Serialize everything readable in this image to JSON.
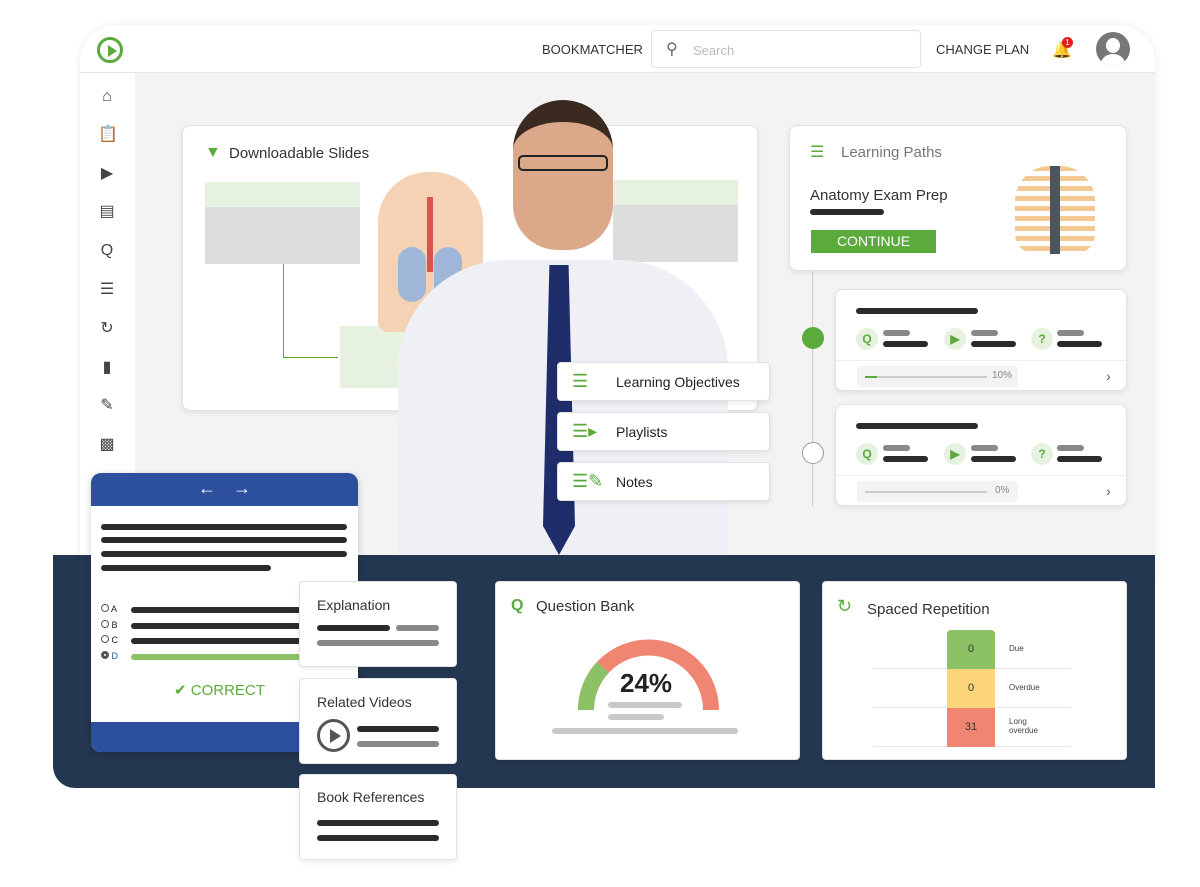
{
  "header": {
    "nav_bookmatcher": "BOOKMATCHER",
    "search_placeholder": "Search",
    "nav_change_plan": "CHANGE PLAN",
    "notification_count": "1"
  },
  "sidebar": {
    "items": [
      "home-icon",
      "clipboard-icon",
      "video-icon",
      "library-icon",
      "question-bank-icon",
      "learning-path-icon",
      "spaced-repetition-icon",
      "bookmark-icon",
      "notes-icon",
      "chart-icon"
    ]
  },
  "slides": {
    "title": "Downloadable Slides"
  },
  "learning_paths": {
    "title": "Learning Paths",
    "path_name": "Anatomy Exam Prep",
    "continue_label": "CONTINUE",
    "modules": [
      {
        "progress_label": "10%",
        "progress": 10,
        "completed": true
      },
      {
        "progress_label": "0%",
        "progress": 0,
        "completed": false
      }
    ]
  },
  "menu": {
    "items": [
      {
        "label": "Learning Objectives",
        "icon": "list-icon"
      },
      {
        "label": "Playlists",
        "icon": "playlist-icon"
      },
      {
        "label": "Notes",
        "icon": "notes-icon"
      }
    ]
  },
  "question": {
    "options": [
      "A",
      "B",
      "C",
      "D"
    ],
    "selected": "D",
    "result_label": "CORRECT"
  },
  "explanation": {
    "title": "Explanation"
  },
  "related_videos": {
    "title": "Related Videos"
  },
  "book_references": {
    "title": "Book References"
  },
  "question_bank": {
    "title": "Question Bank",
    "percent_label": "24%",
    "percent": 24
  },
  "spaced_repetition": {
    "title": "Spaced Repetition",
    "rows": [
      {
        "value": "0",
        "label": "Due",
        "color": "#8cc265"
      },
      {
        "value": "0",
        "label": "Overdue",
        "color": "#fcd47a"
      },
      {
        "value": "31",
        "label": "Long overdue",
        "color": "#f08572"
      }
    ]
  },
  "colors": {
    "accent": "#5aab3c",
    "navy": "#243750",
    "blue": "#2c4f9e"
  }
}
